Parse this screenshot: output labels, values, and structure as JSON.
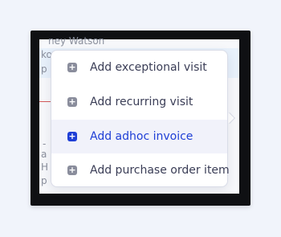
{
  "background": {
    "top_name": "ney Watson",
    "row_b": "ko",
    "row_p": "p",
    "row_dash": "-",
    "row_a": "a",
    "row_h": "H",
    "row_p2": "p"
  },
  "menu": {
    "items": [
      {
        "label": "Add exceptional visit",
        "icon": "plus-square-icon"
      },
      {
        "label": "Add recurring visit",
        "icon": "plus-square-icon"
      },
      {
        "label": "Add adhoc invoice",
        "icon": "plus-square-icon",
        "active": true
      },
      {
        "label": "Add purchase order item",
        "icon": "plus-square-icon"
      }
    ],
    "icon_glyph": "+"
  },
  "colors": {
    "accent": "#1f3fd6",
    "text": "#3a3d56",
    "active_bg": "#f1f2fa"
  }
}
